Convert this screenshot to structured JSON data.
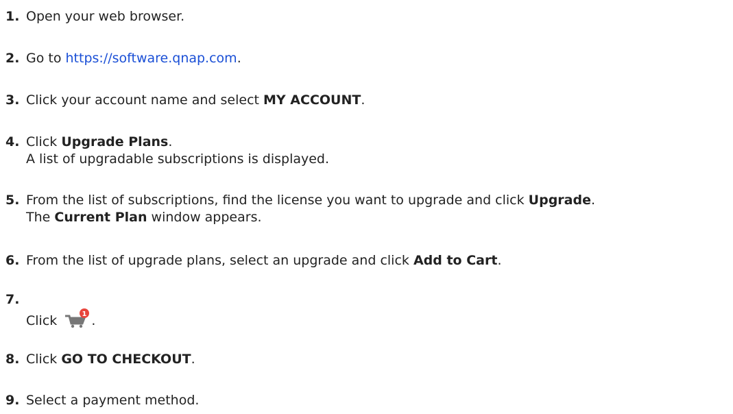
{
  "steps": [
    {
      "num": "1.",
      "text": "Open your web browser."
    },
    {
      "num": "2.",
      "pre": "Go to ",
      "link": "https://software.qnap.com",
      "post": "."
    },
    {
      "num": "3.",
      "pre": "Click your account name and select ",
      "bold": "MY ACCOUNT",
      "post": "."
    },
    {
      "num": "4.",
      "pre": "Click ",
      "bold": "Upgrade Plans",
      "post": ".",
      "line2": "A list of upgradable subscriptions is displayed."
    },
    {
      "num": "5.",
      "pre": "From the list of subscriptions, find the license you want to upgrade and click ",
      "bold": "Upgrade",
      "post": ".",
      "line2_pre": "The ",
      "line2_bold": "Current Plan",
      "line2_post": " window appears."
    },
    {
      "num": "6.",
      "pre": "From the list of upgrade plans, select an upgrade and click ",
      "bold": "Add to Cart",
      "post": "."
    },
    {
      "num": "7.",
      "pre": "Click ",
      "icon": "shopping-cart-icon",
      "badge": "1",
      "post": "."
    },
    {
      "num": "8.",
      "pre": "Click ",
      "bold": "GO TO CHECKOUT",
      "post": "."
    },
    {
      "num": "9.",
      "text": "Select a payment method."
    }
  ],
  "colors": {
    "link": "#1a4fd6",
    "badge": "#e8453c",
    "cart": "#777777"
  }
}
